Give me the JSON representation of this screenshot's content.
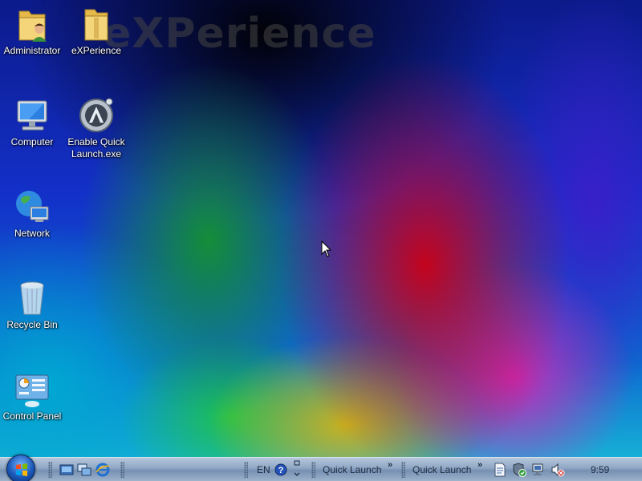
{
  "wallpaper_watermark": "eXPerience",
  "desktop_icons": [
    {
      "label": "Administrator",
      "icon": "user-folder-icon"
    },
    {
      "label": "eXPerience",
      "icon": "folder-icon"
    },
    {
      "label": "Computer",
      "icon": "computer-icon"
    },
    {
      "label": "Enable Quick Launch.exe",
      "icon": "aimp-app-icon"
    },
    {
      "label": "Network",
      "icon": "network-globe-icon"
    },
    {
      "label": "Recycle Bin",
      "icon": "recycle-bin-icon"
    },
    {
      "label": "Control Panel",
      "icon": "control-panel-icon"
    }
  ],
  "taskbar": {
    "start_icon": "windows-start-orb-icon",
    "quick_launch_icons": [
      "show-desktop-icon",
      "switch-windows-icon",
      "internet-explorer-icon"
    ],
    "language": "EN",
    "toolbar_1": "Quick Launch",
    "toolbar_2": "Quick Launch",
    "tray_icons": [
      "document-icon",
      "security-shield-icon",
      "network-status-icon",
      "volume-muted-icon"
    ],
    "clock": "9:59"
  },
  "colors": {
    "taskbar_top": "#b5c7dc",
    "taskbar_bottom": "#7690b2",
    "icon_label": "#ffffff"
  }
}
